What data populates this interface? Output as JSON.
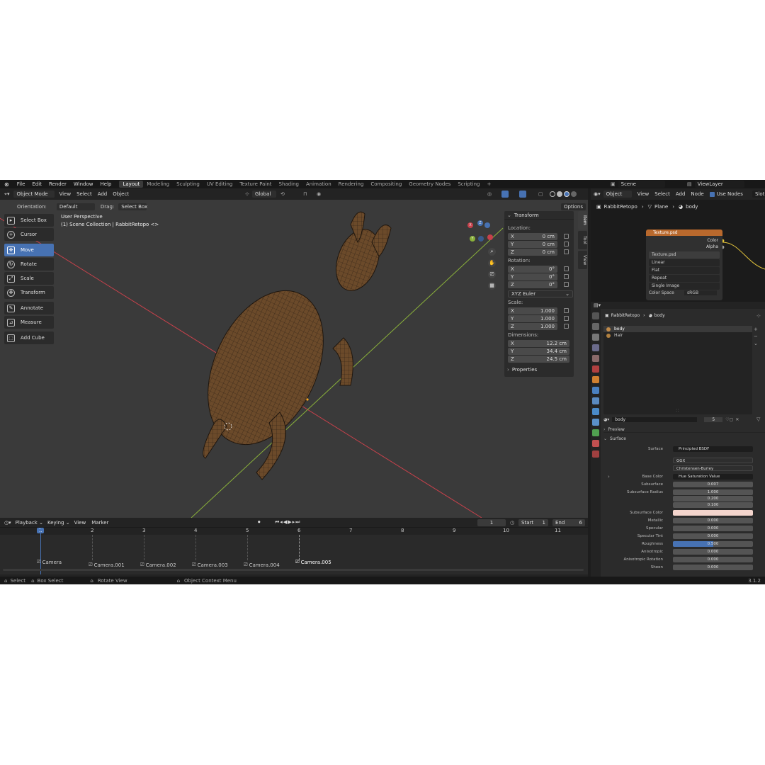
{
  "menu": [
    "File",
    "Edit",
    "Render",
    "Window",
    "Help"
  ],
  "workspaces": [
    "Layout",
    "Modeling",
    "Sculpting",
    "UV Editing",
    "Texture Paint",
    "Shading",
    "Animation",
    "Rendering",
    "Compositing",
    "Geometry Nodes",
    "Scripting"
  ],
  "active_workspace": "Layout",
  "scene": {
    "label": "Scene",
    "view_layer": "ViewLayer"
  },
  "viewport_header": {
    "mode": "Object Mode",
    "menus": [
      "View",
      "Select",
      "Add",
      "Object"
    ],
    "orientation_label": "Orientation:",
    "orientation_value": "Default",
    "drag_label": "Drag:",
    "drag_value": "Select Box",
    "transform_orientation": "Global",
    "options": "Options"
  },
  "viewport_info": {
    "line1": "User Perspective",
    "line2": "(1) Scene Collection | RabbitRetopo <>"
  },
  "gizmo": {
    "x": "X",
    "y": "Y",
    "z": "Z"
  },
  "toolbar": [
    {
      "label": "Select Box",
      "icon": "select-box-icon"
    },
    {
      "label": "Cursor",
      "icon": "cursor-icon"
    },
    {
      "label": "Move",
      "icon": "move-icon",
      "active": true
    },
    {
      "label": "Rotate",
      "icon": "rotate-icon"
    },
    {
      "label": "Scale",
      "icon": "scale-icon"
    },
    {
      "label": "Transform",
      "icon": "transform-icon"
    },
    {
      "label": "Annotate",
      "icon": "annotate-icon"
    },
    {
      "label": "Measure",
      "icon": "measure-icon"
    },
    {
      "label": "Add Cube",
      "icon": "add-cube-icon"
    }
  ],
  "npanel": {
    "title": "Transform",
    "location_label": "Location:",
    "location": [
      {
        "axis": "X",
        "value": "0 cm"
      },
      {
        "axis": "Y",
        "value": "0 cm"
      },
      {
        "axis": "Z",
        "value": "0 cm"
      }
    ],
    "rotation_label": "Rotation:",
    "rotation": [
      {
        "axis": "X",
        "value": "0°"
      },
      {
        "axis": "Y",
        "value": "0°"
      },
      {
        "axis": "Z",
        "value": "0°"
      }
    ],
    "rotation_mode": "XYZ Euler",
    "scale_label": "Scale:",
    "scale": [
      {
        "axis": "X",
        "value": "1.000"
      },
      {
        "axis": "Y",
        "value": "1.000"
      },
      {
        "axis": "Z",
        "value": "1.000"
      }
    ],
    "dimensions_label": "Dimensions:",
    "dimensions": [
      {
        "axis": "X",
        "value": "12.2 cm"
      },
      {
        "axis": "Y",
        "value": "34.4 cm"
      },
      {
        "axis": "Z",
        "value": "24.5 cm"
      }
    ],
    "properties_label": "Properties",
    "tabs": [
      "Item",
      "Tool",
      "View"
    ]
  },
  "timeline": {
    "menus": [
      "Playback",
      "Keying",
      "View",
      "Marker"
    ],
    "current_frame": "1",
    "start_label": "Start",
    "start": "1",
    "end_label": "End",
    "end": "6",
    "ticks": [
      "1",
      "2",
      "3",
      "4",
      "5",
      "6",
      "7",
      "8",
      "9",
      "10",
      "11"
    ],
    "markers": [
      "Camera",
      "Camera.001",
      "Camera.002",
      "Camera.003",
      "Camera.004",
      "Camera.005"
    ]
  },
  "status_bar": {
    "select": "Select",
    "box_select": "Box Select",
    "rotate_view": "Rotate View",
    "context_menu": "Object Context Menu",
    "version": "3.1.2"
  },
  "node_editor": {
    "header_mode": "Object",
    "menus": [
      "View",
      "Select",
      "Add",
      "Node"
    ],
    "use_nodes": "Use Nodes",
    "slot": "Slot",
    "breadcrumb": [
      "RabbitRetopo",
      "Plane",
      "body"
    ],
    "node": {
      "title": "Texture.psd",
      "outputs": [
        "Color",
        "Alpha"
      ],
      "image": "Texture.psd",
      "interpolation": "Linear",
      "projection": "Flat",
      "extension": "Repeat",
      "source": "Single Image",
      "color_space_label": "Color Space",
      "color_space": "sRGB"
    }
  },
  "properties": {
    "breadcrumb": [
      "RabbitRetopo",
      "body"
    ],
    "materials": [
      "body",
      "Hair"
    ],
    "material_name": "body",
    "user_count": "5",
    "preview_label": "Preview",
    "surface_label": "Surface",
    "surface_shader_label": "Surface",
    "surface_shader": "Principled BSDF",
    "distribution": "GGX",
    "subsurface_method": "Christensen-Burley",
    "fields": [
      {
        "label": "Base Color",
        "value": "Hue Saturation Value"
      },
      {
        "label": "Subsurface",
        "value": "0.007"
      },
      {
        "label": "Subsurface Radius",
        "value": "1.000"
      },
      {
        "label": "",
        "value": "0.200"
      },
      {
        "label": "",
        "value": "0.100"
      },
      {
        "label": "Subsurface Color",
        "value": ""
      },
      {
        "label": "Metallic",
        "value": "0.000"
      },
      {
        "label": "Specular",
        "value": "0.000"
      },
      {
        "label": "Specular Tint",
        "value": "0.000"
      },
      {
        "label": "Roughness",
        "value": "0.500"
      },
      {
        "label": "Anisotropic",
        "value": "0.000"
      },
      {
        "label": "Anisotropic Rotation",
        "value": "0.000"
      },
      {
        "label": "Sheen",
        "value": "0.000"
      }
    ],
    "roughness_fill": 0.5,
    "subsurface_color": "#f3d4cc"
  },
  "colors": {
    "accent": "#4772b3",
    "node_header": "#b9692d",
    "axis_x": "#c6414b",
    "axis_y": "#8ab13a",
    "mesh": "#6b4a2a"
  }
}
